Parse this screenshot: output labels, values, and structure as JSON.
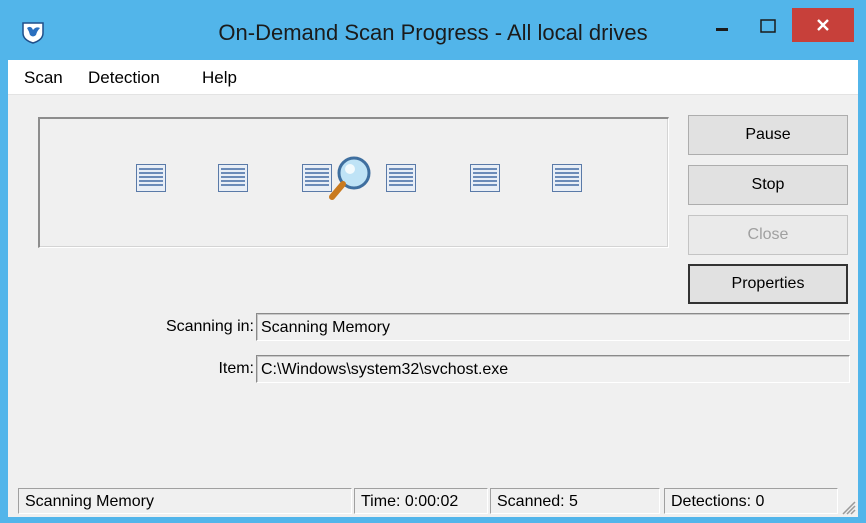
{
  "window": {
    "title": "On-Demand Scan Progress - All local drives",
    "app_icon": "shield-bird-icon",
    "controls": {
      "minimize": "minimize-icon",
      "maximize": "maximize-icon",
      "close": "close-icon"
    },
    "colors": {
      "titlebar": "#52b5ea",
      "close": "#c7403a",
      "client": "#f0f0f0"
    }
  },
  "menu": {
    "items": [
      {
        "label": "Scan"
      },
      {
        "label": "Detection"
      },
      {
        "label": "Help"
      }
    ]
  },
  "scan_animation": {
    "icons": [
      "document-icon",
      "document-icon",
      "document-icon",
      "magnifier-icon",
      "document-icon",
      "document-icon",
      "document-icon"
    ]
  },
  "buttons": {
    "pause": "Pause",
    "stop": "Stop",
    "close": "Close",
    "properties": "Properties"
  },
  "details": {
    "scanning_in_label": "Scanning in:",
    "scanning_in_value": "Scanning Memory",
    "item_label": "Item:",
    "item_value": "C:\\Windows\\system32\\svchost.exe"
  },
  "status": {
    "state": "Scanning Memory",
    "time": "Time: 0:00:02",
    "scanned": "Scanned: 5",
    "detections": "Detections: 0"
  }
}
